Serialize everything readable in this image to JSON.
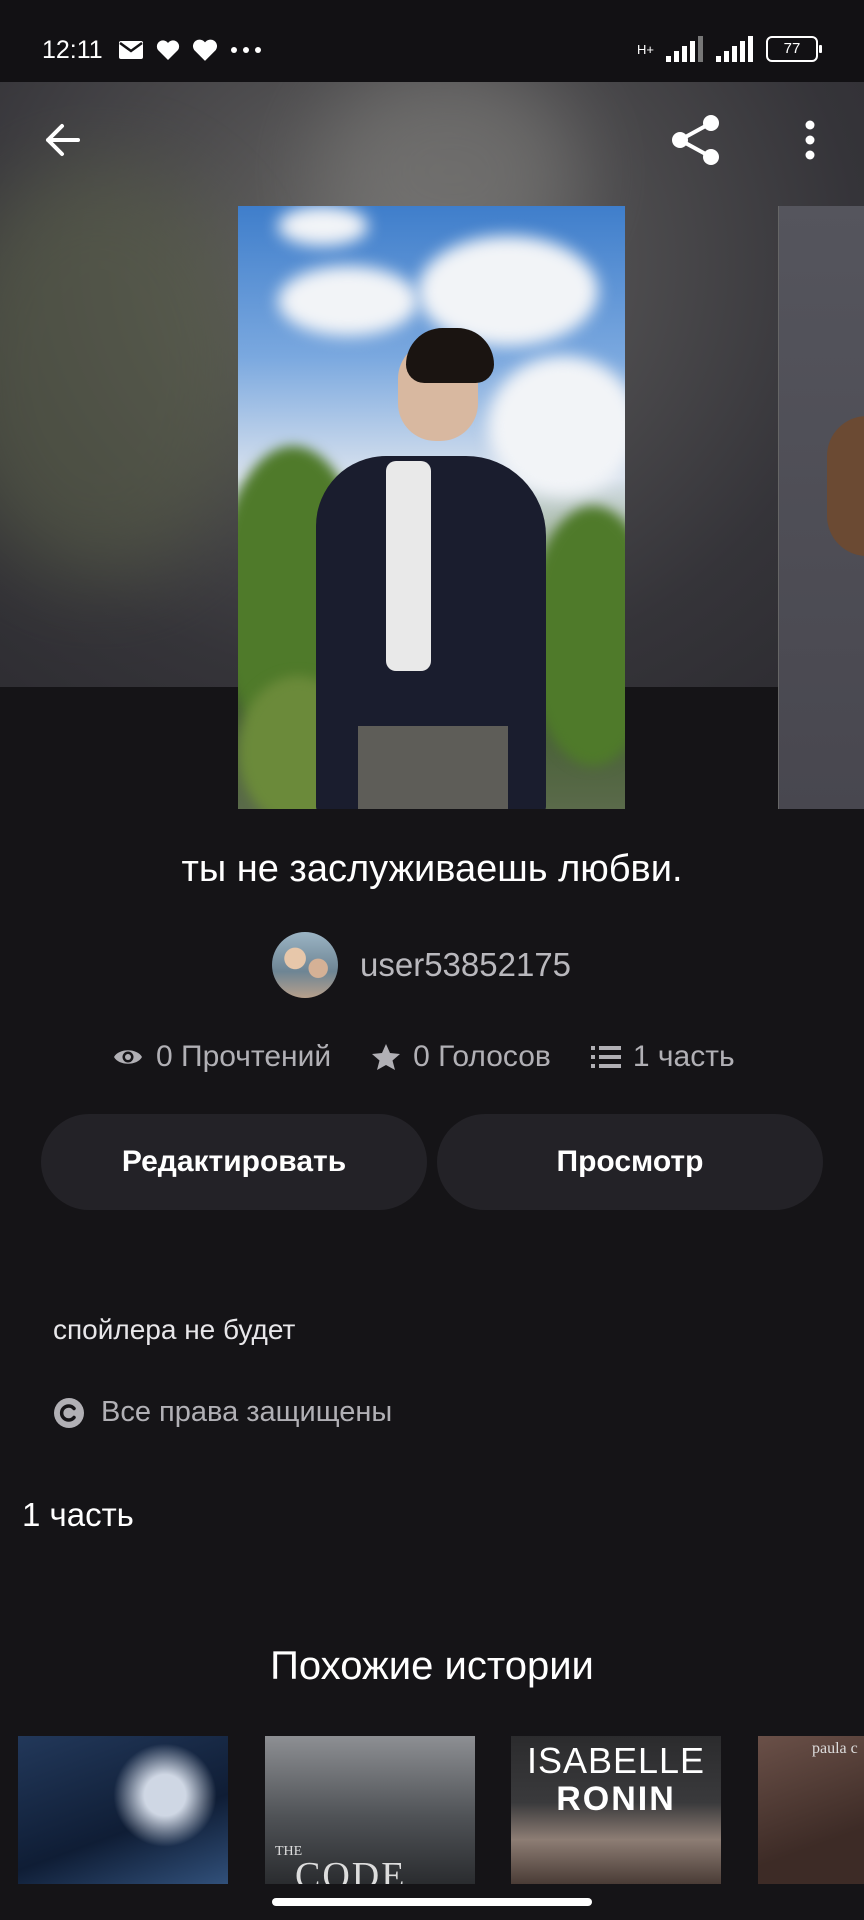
{
  "status_bar": {
    "time": "12:11",
    "network": "H+",
    "battery": "77"
  },
  "story": {
    "title": "ты не заслуживаешь любви.",
    "author": "user53852175",
    "reads": "0 Прочтений",
    "votes": "0 Голосов",
    "parts": "1 часть"
  },
  "actions": {
    "edit_label": "Редактировать",
    "view_label": "Просмотр"
  },
  "description": "спойлера не будет",
  "copyright": "Все права защищены",
  "parts_heading": "1 часть",
  "similar": {
    "heading": "Похожие истории",
    "books": [
      {
        "cover_text": ""
      },
      {
        "cover_small": "THE",
        "cover_text": "CODE"
      },
      {
        "line1": "ISABELLE",
        "line2": "RONIN"
      },
      {
        "cover_text": "paula c"
      }
    ]
  },
  "icons": {
    "back": "arrow-left-icon",
    "share": "share-icon",
    "more": "more-vertical-icon",
    "reads": "eye-icon",
    "votes": "star-icon",
    "parts": "list-icon",
    "copyright": "copyright-icon"
  }
}
